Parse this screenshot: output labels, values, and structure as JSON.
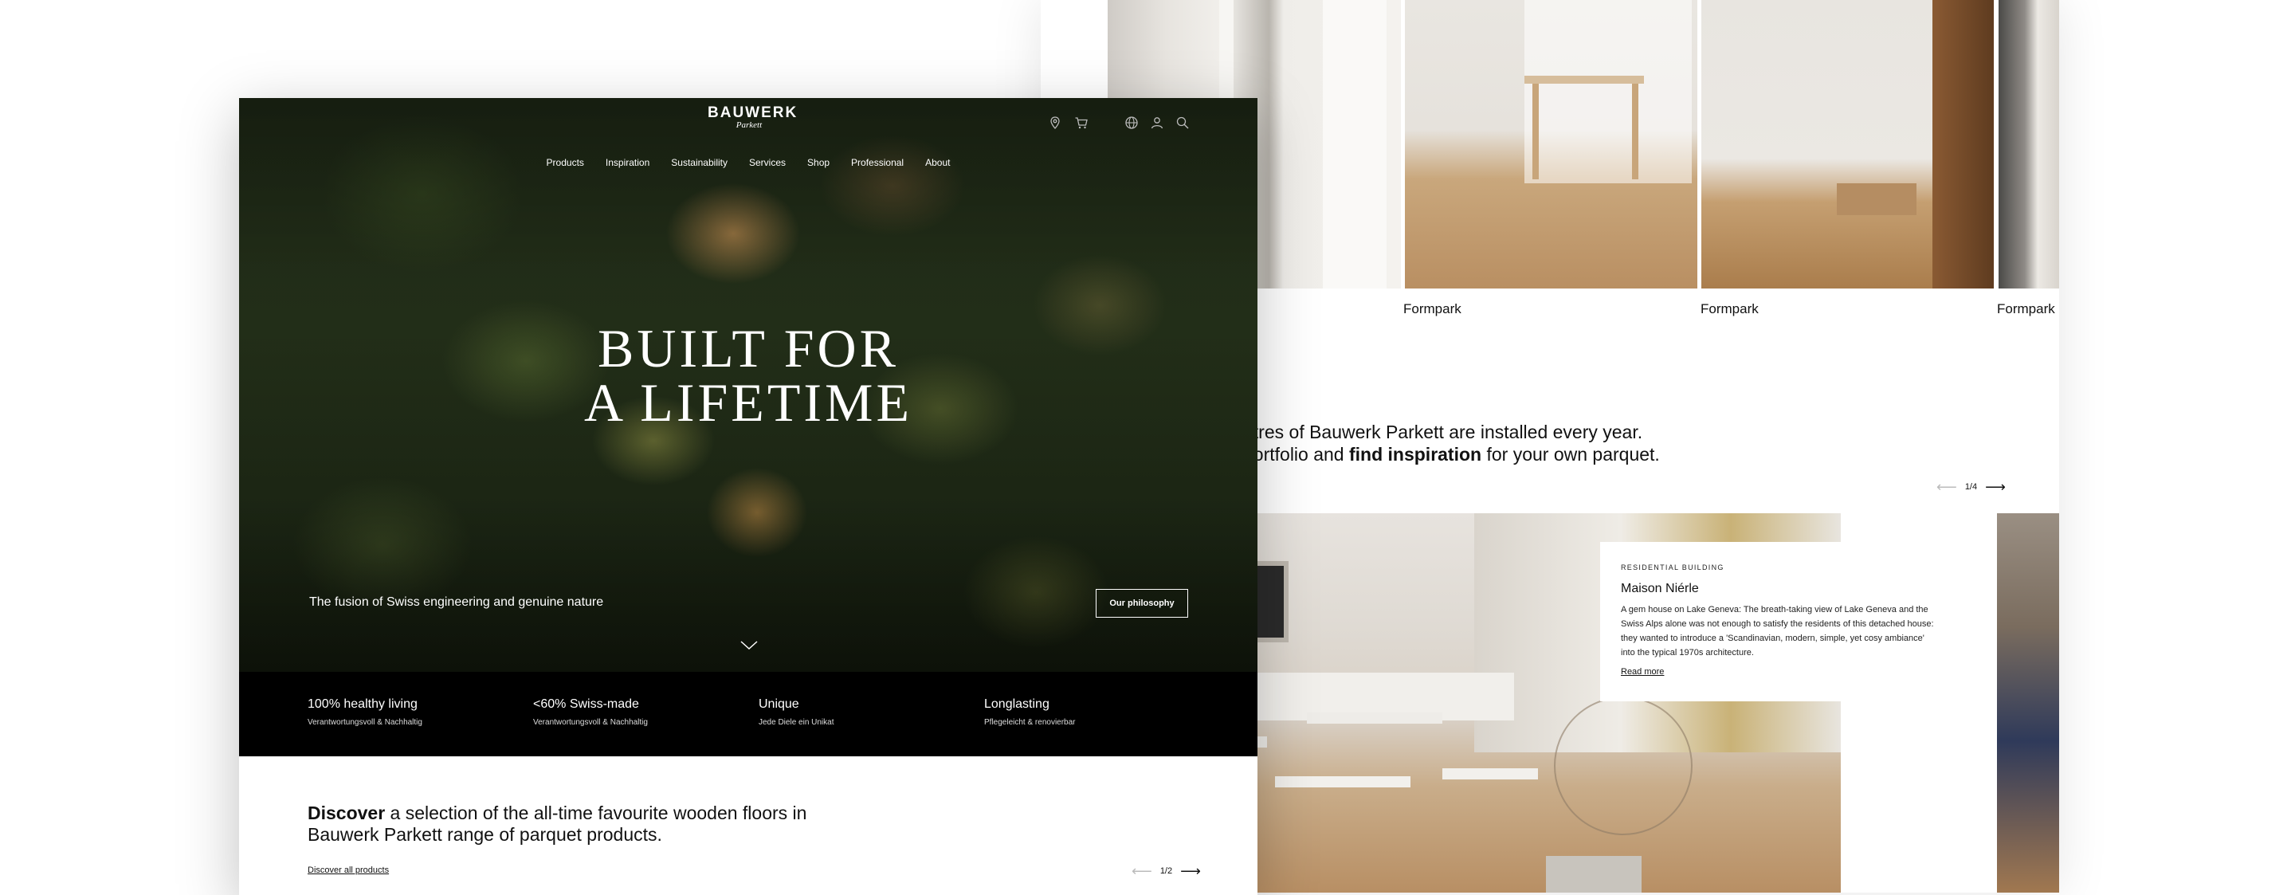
{
  "back_page": {
    "gallery_labels": [
      "Formpark",
      "Formpark",
      "Formpark"
    ],
    "intro": {
      "line1": "etres of Bauwerk Parkett are installed every year.",
      "line2_pre": "portfolio and ",
      "line2_bold": "find inspiration",
      "line2_post": " for your own parquet."
    },
    "pager": {
      "current": "1/4"
    },
    "project_card": {
      "kicker": "RESIDENTIAL BUILDING",
      "title": "Maison Niérle",
      "body": "A gem house on Lake Geneva: The breath-taking view of Lake Geneva and the Swiss Alps alone was not enough to satisfy the residents of this detached house: they wanted to introduce a 'Scandinavian, modern, simple, yet cosy ambiance' into the typical 1970s architecture.",
      "more": "Read more"
    }
  },
  "front_page": {
    "logo": {
      "brand": "BAUWERK",
      "sub": "Parkett"
    },
    "header_icons": [
      "location-pin-icon",
      "cart-icon",
      "globe-icon",
      "user-icon",
      "search-icon"
    ],
    "nav": [
      "Products",
      "Inspiration",
      "Sustainability",
      "Services",
      "Shop",
      "Professional",
      "About"
    ],
    "hero": {
      "headline_line1": "BUILT FOR",
      "headline_line2": "A LIFETIME",
      "subline": "The fusion of Swiss engineering and genuine nature",
      "cta": "Our philosophy"
    },
    "features": [
      {
        "title": "100% healthy living",
        "subtitle": "Verantwortungsvoll & Nachhaltig"
      },
      {
        "title": "<60% Swiss-made",
        "subtitle": "Verantwortungsvoll & Nachhaltig"
      },
      {
        "title": "Unique",
        "subtitle": "Jede Diele ein Unikat"
      },
      {
        "title": "Longlasting",
        "subtitle": "Pflegeleicht & renovierbar"
      }
    ],
    "discover": {
      "bold": "Discover",
      "rest": " a selection of the all-time favourite wooden floors in Bauwerk Parkett range of parquet products.",
      "link": "Discover all products",
      "pager": "1/2"
    }
  }
}
